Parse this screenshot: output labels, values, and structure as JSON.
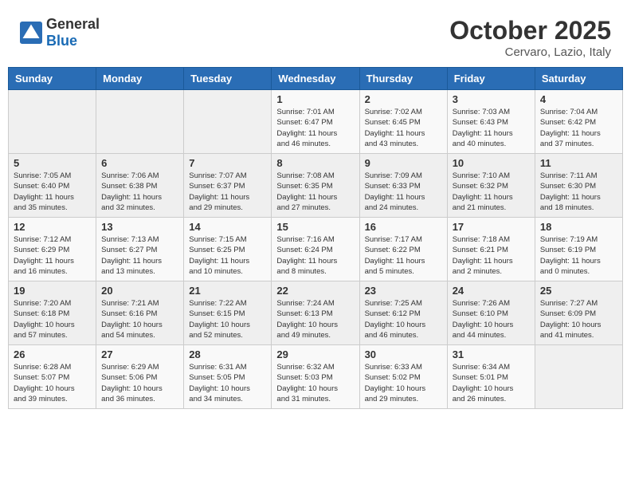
{
  "header": {
    "logo_general": "General",
    "logo_blue": "Blue",
    "month": "October 2025",
    "location": "Cervaro, Lazio, Italy"
  },
  "weekdays": [
    "Sunday",
    "Monday",
    "Tuesday",
    "Wednesday",
    "Thursday",
    "Friday",
    "Saturday"
  ],
  "weeks": [
    [
      {
        "day": "",
        "info": ""
      },
      {
        "day": "",
        "info": ""
      },
      {
        "day": "",
        "info": ""
      },
      {
        "day": "1",
        "info": "Sunrise: 7:01 AM\nSunset: 6:47 PM\nDaylight: 11 hours\nand 46 minutes."
      },
      {
        "day": "2",
        "info": "Sunrise: 7:02 AM\nSunset: 6:45 PM\nDaylight: 11 hours\nand 43 minutes."
      },
      {
        "day": "3",
        "info": "Sunrise: 7:03 AM\nSunset: 6:43 PM\nDaylight: 11 hours\nand 40 minutes."
      },
      {
        "day": "4",
        "info": "Sunrise: 7:04 AM\nSunset: 6:42 PM\nDaylight: 11 hours\nand 37 minutes."
      }
    ],
    [
      {
        "day": "5",
        "info": "Sunrise: 7:05 AM\nSunset: 6:40 PM\nDaylight: 11 hours\nand 35 minutes."
      },
      {
        "day": "6",
        "info": "Sunrise: 7:06 AM\nSunset: 6:38 PM\nDaylight: 11 hours\nand 32 minutes."
      },
      {
        "day": "7",
        "info": "Sunrise: 7:07 AM\nSunset: 6:37 PM\nDaylight: 11 hours\nand 29 minutes."
      },
      {
        "day": "8",
        "info": "Sunrise: 7:08 AM\nSunset: 6:35 PM\nDaylight: 11 hours\nand 27 minutes."
      },
      {
        "day": "9",
        "info": "Sunrise: 7:09 AM\nSunset: 6:33 PM\nDaylight: 11 hours\nand 24 minutes."
      },
      {
        "day": "10",
        "info": "Sunrise: 7:10 AM\nSunset: 6:32 PM\nDaylight: 11 hours\nand 21 minutes."
      },
      {
        "day": "11",
        "info": "Sunrise: 7:11 AM\nSunset: 6:30 PM\nDaylight: 11 hours\nand 18 minutes."
      }
    ],
    [
      {
        "day": "12",
        "info": "Sunrise: 7:12 AM\nSunset: 6:29 PM\nDaylight: 11 hours\nand 16 minutes."
      },
      {
        "day": "13",
        "info": "Sunrise: 7:13 AM\nSunset: 6:27 PM\nDaylight: 11 hours\nand 13 minutes."
      },
      {
        "day": "14",
        "info": "Sunrise: 7:15 AM\nSunset: 6:25 PM\nDaylight: 11 hours\nand 10 minutes."
      },
      {
        "day": "15",
        "info": "Sunrise: 7:16 AM\nSunset: 6:24 PM\nDaylight: 11 hours\nand 8 minutes."
      },
      {
        "day": "16",
        "info": "Sunrise: 7:17 AM\nSunset: 6:22 PM\nDaylight: 11 hours\nand 5 minutes."
      },
      {
        "day": "17",
        "info": "Sunrise: 7:18 AM\nSunset: 6:21 PM\nDaylight: 11 hours\nand 2 minutes."
      },
      {
        "day": "18",
        "info": "Sunrise: 7:19 AM\nSunset: 6:19 PM\nDaylight: 11 hours\nand 0 minutes."
      }
    ],
    [
      {
        "day": "19",
        "info": "Sunrise: 7:20 AM\nSunset: 6:18 PM\nDaylight: 10 hours\nand 57 minutes."
      },
      {
        "day": "20",
        "info": "Sunrise: 7:21 AM\nSunset: 6:16 PM\nDaylight: 10 hours\nand 54 minutes."
      },
      {
        "day": "21",
        "info": "Sunrise: 7:22 AM\nSunset: 6:15 PM\nDaylight: 10 hours\nand 52 minutes."
      },
      {
        "day": "22",
        "info": "Sunrise: 7:24 AM\nSunset: 6:13 PM\nDaylight: 10 hours\nand 49 minutes."
      },
      {
        "day": "23",
        "info": "Sunrise: 7:25 AM\nSunset: 6:12 PM\nDaylight: 10 hours\nand 46 minutes."
      },
      {
        "day": "24",
        "info": "Sunrise: 7:26 AM\nSunset: 6:10 PM\nDaylight: 10 hours\nand 44 minutes."
      },
      {
        "day": "25",
        "info": "Sunrise: 7:27 AM\nSunset: 6:09 PM\nDaylight: 10 hours\nand 41 minutes."
      }
    ],
    [
      {
        "day": "26",
        "info": "Sunrise: 6:28 AM\nSunset: 5:07 PM\nDaylight: 10 hours\nand 39 minutes."
      },
      {
        "day": "27",
        "info": "Sunrise: 6:29 AM\nSunset: 5:06 PM\nDaylight: 10 hours\nand 36 minutes."
      },
      {
        "day": "28",
        "info": "Sunrise: 6:31 AM\nSunset: 5:05 PM\nDaylight: 10 hours\nand 34 minutes."
      },
      {
        "day": "29",
        "info": "Sunrise: 6:32 AM\nSunset: 5:03 PM\nDaylight: 10 hours\nand 31 minutes."
      },
      {
        "day": "30",
        "info": "Sunrise: 6:33 AM\nSunset: 5:02 PM\nDaylight: 10 hours\nand 29 minutes."
      },
      {
        "day": "31",
        "info": "Sunrise: 6:34 AM\nSunset: 5:01 PM\nDaylight: 10 hours\nand 26 minutes."
      },
      {
        "day": "",
        "info": ""
      }
    ]
  ]
}
